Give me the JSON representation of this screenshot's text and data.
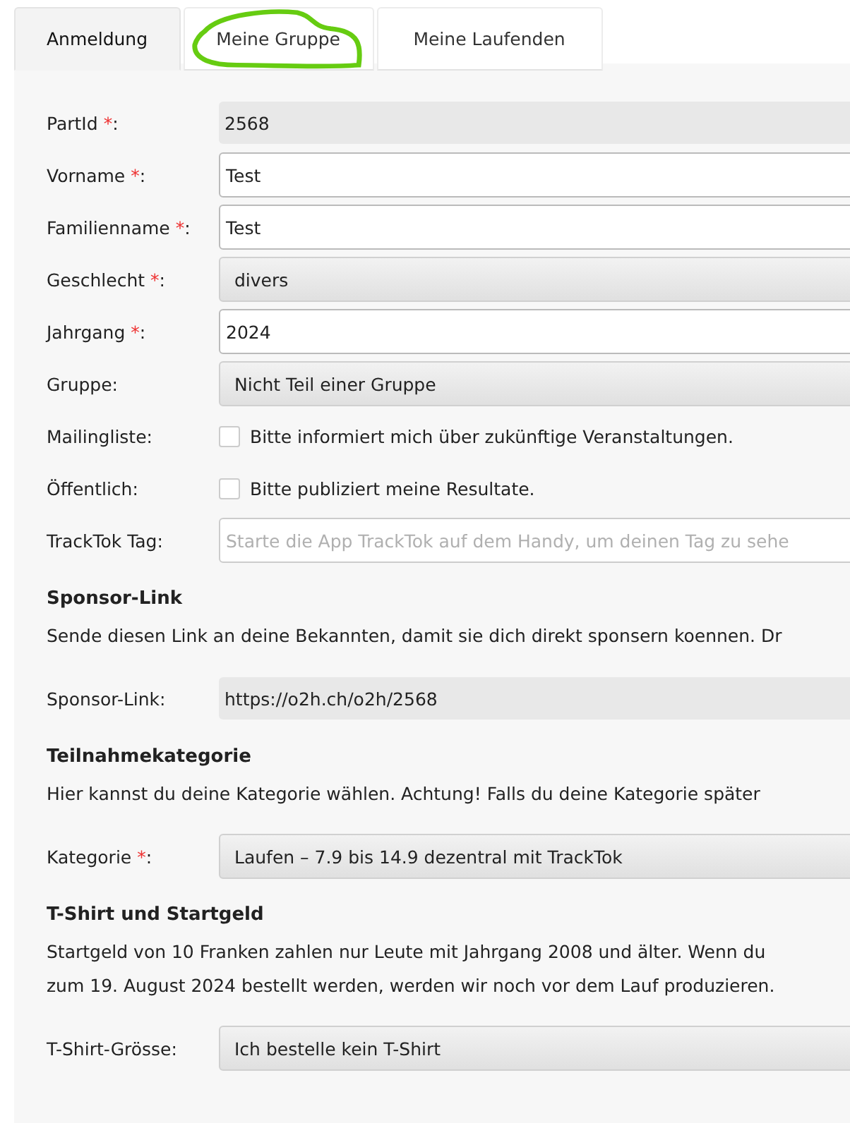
{
  "tabs": [
    {
      "label": "Anmeldung",
      "selected": true
    },
    {
      "label": "Meine Gruppe",
      "selected": false
    },
    {
      "label": "Meine Laufenden",
      "selected": false
    }
  ],
  "fields": [
    {
      "kind": "readonly",
      "label": "PartId",
      "required_mark": "*",
      "label_end": ":",
      "value": "2568"
    },
    {
      "kind": "text",
      "label": "Vorname",
      "required_mark": "*",
      "label_end": ":",
      "value": "Test"
    },
    {
      "kind": "text",
      "label": "Familienname",
      "required_mark": "*",
      "label_end": ":",
      "value": "Test"
    },
    {
      "kind": "select",
      "label": "Geschlecht",
      "required_mark": "*",
      "label_end": ":",
      "value": "divers"
    },
    {
      "kind": "text",
      "label": "Jahrgang",
      "required_mark": "*",
      "label_end": ":",
      "value": "2024"
    },
    {
      "kind": "select",
      "label": "Gruppe:",
      "value": "Nicht Teil einer Gruppe"
    },
    {
      "kind": "checkbox",
      "label": "Mailingliste:",
      "checked": false,
      "value": "Bitte informiert mich über zukünftige Veranstaltungen."
    },
    {
      "kind": "checkbox",
      "label": "Öffentlich:",
      "checked": false,
      "value": "Bitte publiziert meine Resultate."
    },
    {
      "kind": "placeholder",
      "label": "TrackTok Tag:",
      "placeholder": "Starte die App TrackTok auf dem Handy, um deinen Tag zu sehe"
    }
  ],
  "sections": [
    {
      "title": "Sponsor-Link",
      "text": [
        "Sende diesen Link an deine Bekannten, damit sie dich direkt sponsern koennen. Dr"
      ],
      "fields": [
        {
          "kind": "readonly",
          "label": "Sponsor-Link:",
          "value": "https://o2h.ch/o2h/2568"
        }
      ]
    },
    {
      "title": "Teilnahmekategorie",
      "text": [
        "Hier kannst du deine Kategorie wählen. Achtung! Falls du deine Kategorie später"
      ],
      "fields": [
        {
          "kind": "select",
          "label": "Kategorie",
          "required_mark": "*",
          "label_end": ":",
          "value": "Laufen – 7.9 bis 14.9 dezentral mit TrackTok"
        }
      ]
    },
    {
      "title": "T-Shirt und Startgeld",
      "text": [
        "Startgeld von 10 Franken zahlen nur Leute mit Jahrgang 2008 und älter. Wenn du",
        "zum 19. August 2024 bestellt werden, werden wir noch vor dem Lauf produzieren."
      ],
      "fields": [
        {
          "kind": "select",
          "label": "T-Shirt-Grösse:",
          "value": "Ich bestelle kein T-Shirt"
        }
      ]
    }
  ]
}
